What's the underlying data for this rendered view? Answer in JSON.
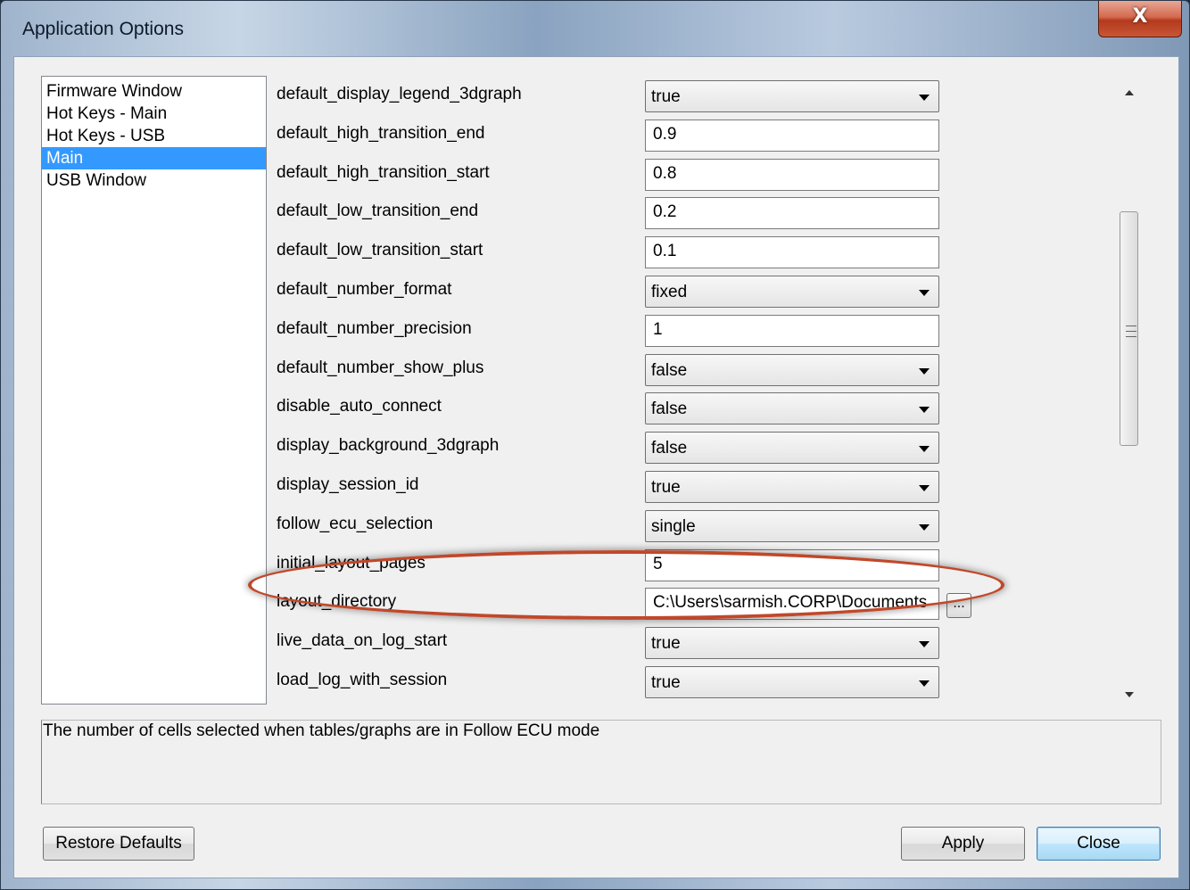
{
  "window": {
    "title": "Application Options",
    "close_glyph": "X"
  },
  "categories": [
    {
      "label": "Firmware Window"
    },
    {
      "label": "Hot Keys - Main"
    },
    {
      "label": "Hot Keys - USB"
    },
    {
      "label": "Main",
      "selected": true
    },
    {
      "label": "USB Window"
    }
  ],
  "properties": [
    {
      "name": "default_display_legend_3dgraph",
      "type": "combo",
      "value": "true"
    },
    {
      "name": "default_high_transition_end",
      "type": "text",
      "value": "0.9"
    },
    {
      "name": "default_high_transition_start",
      "type": "text",
      "value": "0.8"
    },
    {
      "name": "default_low_transition_end",
      "type": "text",
      "value": "0.2"
    },
    {
      "name": "default_low_transition_start",
      "type": "text",
      "value": "0.1"
    },
    {
      "name": "default_number_format",
      "type": "combo",
      "value": "fixed"
    },
    {
      "name": "default_number_precision",
      "type": "text",
      "value": "1"
    },
    {
      "name": "default_number_show_plus",
      "type": "combo",
      "value": "false"
    },
    {
      "name": "disable_auto_connect",
      "type": "combo",
      "value": "false"
    },
    {
      "name": "display_background_3dgraph",
      "type": "combo",
      "value": "false"
    },
    {
      "name": "display_session_id",
      "type": "combo",
      "value": "true"
    },
    {
      "name": "follow_ecu_selection",
      "type": "combo",
      "value": "single"
    },
    {
      "name": "initial_layout_pages",
      "type": "text",
      "value": "5"
    },
    {
      "name": "layout_directory",
      "type": "path",
      "value": "C:\\Users\\sarmish.CORP\\Documents",
      "browse_label": "..."
    },
    {
      "name": "live_data_on_log_start",
      "type": "combo",
      "value": "true"
    },
    {
      "name": "load_log_with_session",
      "type": "combo",
      "value": "true"
    }
  ],
  "description": "The number of cells selected when tables/graphs are in Follow ECU mode",
  "buttons": {
    "restore_defaults": "Restore Defaults",
    "apply": "Apply",
    "close": "Close"
  },
  "colors": {
    "selection": "#3399ff",
    "highlight_oval": "#c0482a",
    "close_button": "#c85636"
  }
}
